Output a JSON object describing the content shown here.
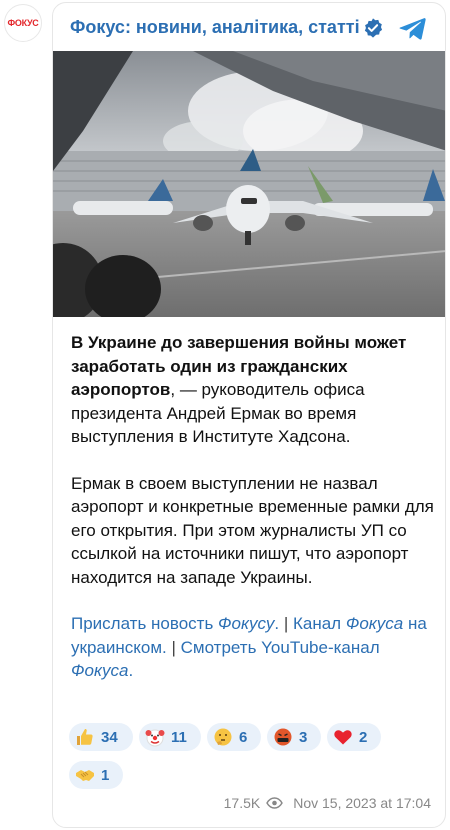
{
  "avatar": {
    "text": "ФОКУС"
  },
  "header": {
    "channel_title": "Фокус: новини, аналітика, статті"
  },
  "post": {
    "bold_lead": "В Украине до завершения войны может заработать один из гражданских аэропортов",
    "lead_rest": ", — руководитель офиса президента Андрей Ермак во время выступления в Институте Хадсона.",
    "paragraph2": "Ермак в своем выступлении не назвал аэропорт и конкретные временные рамки для его открытия. При этом журналисты УП со ссылкой на источники пишут, что аэропорт находится на западе Украины.",
    "links": {
      "send_news_prefix": "Прислать новость ",
      "send_news_italic": "Фокусу",
      "send_news_suffix": ".",
      "sep1": " | ",
      "channel_prefix": "Канал ",
      "channel_italic": "Фокуса",
      "channel_suffix": " на украинском.",
      "sep2": " | ",
      "watch_prefix": "Смотреть YouTube-канал ",
      "watch_italic": "Фокуса",
      "watch_suffix": "."
    }
  },
  "reactions": [
    {
      "icon": "thumbs-up-icon",
      "count": "34"
    },
    {
      "icon": "clown-face-icon",
      "count": "11"
    },
    {
      "icon": "thinking-face-icon",
      "count": "6"
    },
    {
      "icon": "cursing-face-icon",
      "count": "3"
    },
    {
      "icon": "red-heart-icon",
      "count": "2"
    },
    {
      "icon": "handshake-icon",
      "count": "1"
    }
  ],
  "footer": {
    "views": "17.5K",
    "timestamp": "Nov 15, 2023 at 17:04"
  },
  "colors": {
    "link": "#2c6fb3",
    "reaction_bg": "#e9f1fa",
    "brand_red": "#e3262b",
    "meta": "#888888"
  }
}
